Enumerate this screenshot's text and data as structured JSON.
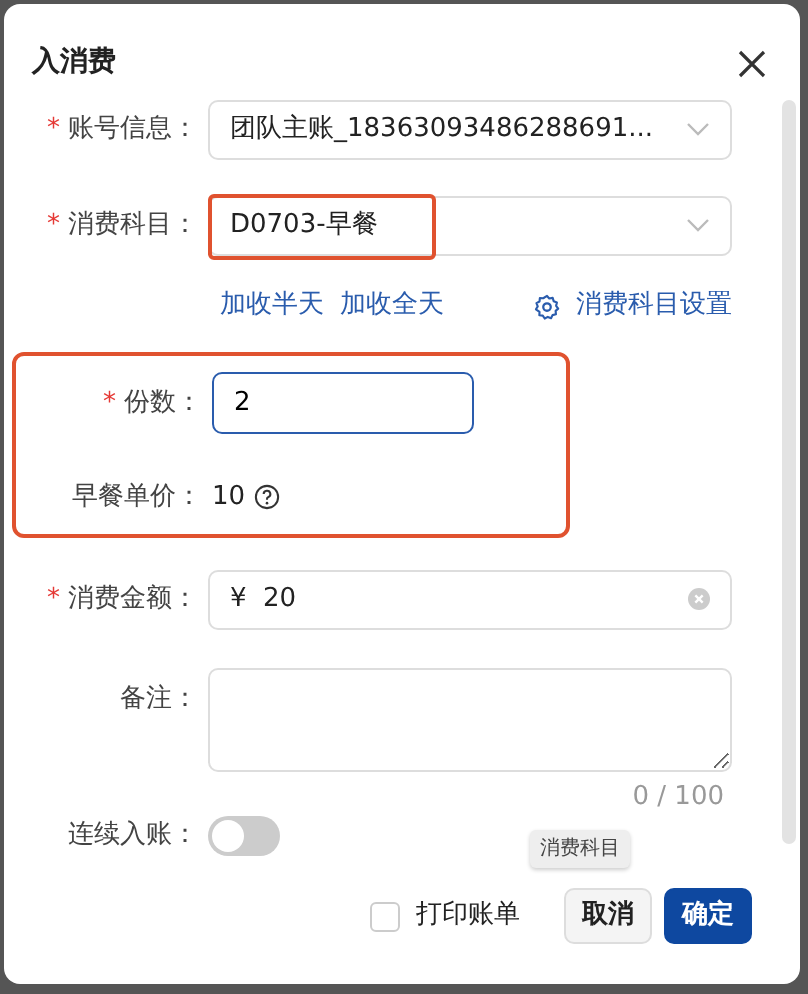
{
  "dialog": {
    "title": "入消费"
  },
  "groups": [
    {
      "fields": [
        {
          "kind": "select",
          "marker": "*",
          "label": "账号信息：",
          "value": "团队主账_18363093486288691..."
        },
        {
          "kind": "select",
          "marker": "*",
          "label": "消费科目：",
          "value": "D0703-早餐",
          "value_highlighted": true,
          "links": [
            "加收半天",
            "加收全天"
          ],
          "settings_link": "消费科目设置"
        }
      ]
    },
    {
      "highlighted": true,
      "fields": [
        {
          "kind": "input",
          "marker": "*",
          "label": "份数：",
          "value": "2",
          "focused": true
        },
        {
          "kind": "static",
          "label": "早餐单价：",
          "value": "10",
          "help": true
        }
      ]
    },
    {
      "fields": [
        {
          "kind": "amount",
          "marker": "*",
          "label": "消费金额：",
          "prefix": "¥",
          "value": "20",
          "clearable": true
        },
        {
          "kind": "textarea",
          "label": "备注：",
          "counter": "0 / 100"
        },
        {
          "kind": "switch",
          "label": "连续入账：",
          "on": false
        }
      ]
    }
  ],
  "tooltip": "消费科目",
  "footer": {
    "checkbox": {
      "label": "打印账单",
      "checked": false
    },
    "buttons": [
      {
        "label": "取消",
        "kind": "secondary"
      },
      {
        "label": "确定",
        "kind": "primary"
      }
    ]
  }
}
